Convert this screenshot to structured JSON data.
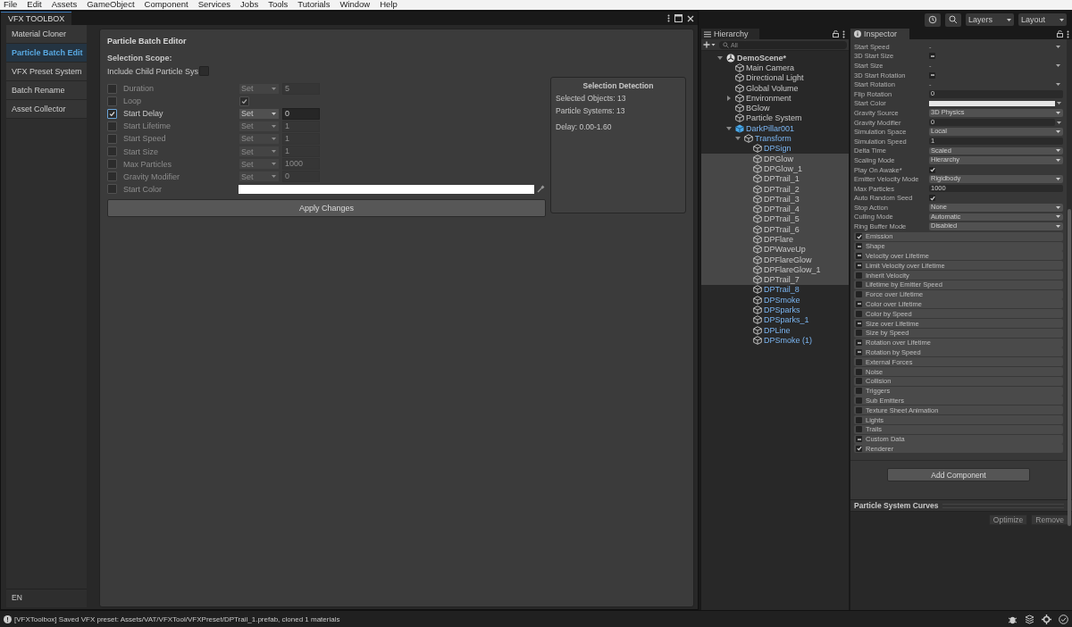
{
  "menu_bar": [
    "File",
    "Edit",
    "Assets",
    "GameObject",
    "Component",
    "Services",
    "Jobs",
    "Tools",
    "Tutorials",
    "Window",
    "Help"
  ],
  "toolbox": {
    "title": "VFX TOOLBOX",
    "sidebar": [
      {
        "label": "Material Cloner",
        "selected": false
      },
      {
        "label": "Particle Batch Edit",
        "selected": true
      },
      {
        "label": "VFX Preset System",
        "selected": false
      },
      {
        "label": "Batch Rename",
        "selected": false
      },
      {
        "label": "Asset Collector",
        "selected": false
      }
    ],
    "language": "EN",
    "editor": {
      "title": "Particle Batch Editor",
      "scope_label": "Selection Scope:",
      "include_child": {
        "label": "Include Child Particle Sys",
        "checked": false
      },
      "rows": [
        {
          "kind": "value",
          "label": "Duration",
          "enabled": false,
          "mode": "Set",
          "value": "5"
        },
        {
          "kind": "toggle",
          "label": "Loop",
          "enabled": false,
          "checked": true
        },
        {
          "kind": "value",
          "label": "Start Delay",
          "enabled": true,
          "mode": "Set",
          "value": "0"
        },
        {
          "kind": "value",
          "label": "Start Lifetime",
          "enabled": false,
          "mode": "Set",
          "value": "1"
        },
        {
          "kind": "value",
          "label": "Start Speed",
          "enabled": false,
          "mode": "Set",
          "value": "1"
        },
        {
          "kind": "value",
          "label": "Start Size",
          "enabled": false,
          "mode": "Set",
          "value": "1"
        },
        {
          "kind": "value",
          "label": "Max Particles",
          "enabled": false,
          "mode": "Set",
          "value": "1000"
        },
        {
          "kind": "value",
          "label": "Gravity Modifier",
          "enabled": false,
          "mode": "Set",
          "value": "0"
        },
        {
          "kind": "color",
          "label": "Start Color",
          "enabled": false
        }
      ],
      "apply_button": "Apply Changes",
      "detection": {
        "title": "Selection Detection",
        "lines": [
          "Selected Objects: 13",
          "Particle Systems: 13"
        ],
        "delay": "Delay: 0.00-1.60"
      }
    }
  },
  "toolbar": {
    "layers": "Layers",
    "layout": "Layout"
  },
  "hierarchy": {
    "title": "Hierarchy",
    "search": {
      "placeholder": "All"
    },
    "tree": [
      {
        "name": "DemoScene*",
        "kind": "scene",
        "linked": false,
        "selected": false,
        "expanded": true,
        "children": [
          {
            "name": "Main Camera",
            "kind": "object",
            "linked": false,
            "selected": false
          },
          {
            "name": "Directional Light",
            "kind": "object",
            "linked": false,
            "selected": false
          },
          {
            "name": "Global Volume",
            "kind": "object",
            "linked": false,
            "selected": false
          },
          {
            "name": "Environment",
            "kind": "object",
            "linked": false,
            "selected": false,
            "expanded": false
          },
          {
            "name": "BGlow",
            "kind": "object",
            "linked": false,
            "selected": false
          },
          {
            "name": "Particle System",
            "kind": "object",
            "linked": false,
            "selected": false
          },
          {
            "name": "DarkPillar001",
            "kind": "prefab",
            "linked": true,
            "selected": false,
            "expanded": true,
            "children": [
              {
                "name": "Transform",
                "kind": "object",
                "linked": true,
                "selected": false,
                "expanded": true,
                "children": [
                  {
                    "name": "DPSign",
                    "kind": "object",
                    "linked": true,
                    "selected": false
                  },
                  {
                    "name": "DPGlow",
                    "kind": "object",
                    "linked": false,
                    "selected": true
                  },
                  {
                    "name": "DPGlow_1",
                    "kind": "object",
                    "linked": false,
                    "selected": true
                  },
                  {
                    "name": "DPTrail_1",
                    "kind": "object",
                    "linked": false,
                    "selected": true
                  },
                  {
                    "name": "DPTrail_2",
                    "kind": "object",
                    "linked": false,
                    "selected": true
                  },
                  {
                    "name": "DPTrail_3",
                    "kind": "object",
                    "linked": false,
                    "selected": true
                  },
                  {
                    "name": "DPTrail_4",
                    "kind": "object",
                    "linked": false,
                    "selected": true
                  },
                  {
                    "name": "DPTrail_5",
                    "kind": "object",
                    "linked": false,
                    "selected": true
                  },
                  {
                    "name": "DPTrail_6",
                    "kind": "object",
                    "linked": false,
                    "selected": true
                  },
                  {
                    "name": "DPFlare",
                    "kind": "object",
                    "linked": false,
                    "selected": true
                  },
                  {
                    "name": "DPWaveUp",
                    "kind": "object",
                    "linked": false,
                    "selected": true
                  },
                  {
                    "name": "DPFlareGlow",
                    "kind": "object",
                    "linked": false,
                    "selected": true
                  },
                  {
                    "name": "DPFlareGlow_1",
                    "kind": "object",
                    "linked": false,
                    "selected": true
                  },
                  {
                    "name": "DPTrail_7",
                    "kind": "object",
                    "linked": false,
                    "selected": true
                  },
                  {
                    "name": "DPTrail_8",
                    "kind": "object",
                    "linked": true,
                    "selected": false
                  },
                  {
                    "name": "DPSmoke",
                    "kind": "object",
                    "linked": true,
                    "selected": false
                  },
                  {
                    "name": "DPSparks",
                    "kind": "object",
                    "linked": true,
                    "selected": false
                  },
                  {
                    "name": "DPSparks_1",
                    "kind": "object",
                    "linked": true,
                    "selected": false
                  },
                  {
                    "name": "DPLine",
                    "kind": "object",
                    "linked": true,
                    "selected": false
                  },
                  {
                    "name": "DPSmoke (1)",
                    "kind": "object",
                    "linked": true,
                    "selected": false
                  }
                ]
              }
            ]
          }
        ]
      }
    ]
  },
  "inspector": {
    "title": "Inspector",
    "properties": [
      {
        "label": "Start Speed",
        "kind": "curve",
        "value": "-"
      },
      {
        "label": "3D Start Size",
        "kind": "toggle",
        "mixed": true
      },
      {
        "label": "Start Size",
        "kind": "curve",
        "value": "-"
      },
      {
        "label": "3D Start Rotation",
        "kind": "toggle",
        "mixed": true
      },
      {
        "label": "Start Rotation",
        "kind": "curve",
        "value": "-"
      },
      {
        "label": "Flip Rotation",
        "kind": "field",
        "value": "0"
      },
      {
        "label": "Start Color",
        "kind": "color"
      },
      {
        "label": "Gravity Source",
        "kind": "dropdown",
        "value": "3D Physics"
      },
      {
        "label": "Gravity Modifier",
        "kind": "field_curve",
        "value": "0"
      },
      {
        "label": "Simulation Space",
        "kind": "dropdown",
        "value": "Local"
      },
      {
        "label": "Simulation Speed",
        "kind": "field",
        "value": "1"
      },
      {
        "label": "Delta Time",
        "kind": "dropdown",
        "value": "Scaled"
      },
      {
        "label": "Scaling Mode",
        "kind": "dropdown",
        "value": "Hierarchy"
      },
      {
        "label": "Play On Awake*",
        "kind": "toggle",
        "checked": true
      },
      {
        "label": "Emitter Velocity Mode",
        "kind": "dropdown",
        "value": "Rigidbody"
      },
      {
        "label": "Max Particles",
        "kind": "field",
        "value": "1000"
      },
      {
        "label": "Auto Random Seed",
        "kind": "toggle",
        "checked": true
      },
      {
        "label": "Stop Action",
        "kind": "dropdown",
        "value": "None"
      },
      {
        "label": "Culling Mode",
        "kind": "dropdown",
        "value": "Automatic"
      },
      {
        "label": "Ring Buffer Mode",
        "kind": "dropdown",
        "value": "Disabled"
      }
    ],
    "modules": [
      {
        "label": "Emission",
        "checked": true
      },
      {
        "label": "Shape",
        "mixed": true
      },
      {
        "label": "Velocity over Lifetime",
        "mixed": true
      },
      {
        "label": "Limit Velocity over Lifetime",
        "mixed": true
      },
      {
        "label": "Inherit Velocity",
        "checked": false
      },
      {
        "label": "Lifetime by Emitter Speed",
        "checked": false
      },
      {
        "label": "Force over Lifetime",
        "checked": false
      },
      {
        "label": "Color over Lifetime",
        "mixed": true
      },
      {
        "label": "Color by Speed",
        "checked": false
      },
      {
        "label": "Size over Lifetime",
        "mixed": true
      },
      {
        "label": "Size by Speed",
        "checked": false
      },
      {
        "label": "Rotation over Lifetime",
        "mixed": true
      },
      {
        "label": "Rotation by Speed",
        "mixed": true
      },
      {
        "label": "External Forces",
        "checked": false
      },
      {
        "label": "Noise",
        "checked": false
      },
      {
        "label": "Collision",
        "checked": false
      },
      {
        "label": "Triggers",
        "checked": false
      },
      {
        "label": "Sub Emitters",
        "checked": false
      },
      {
        "label": "Texture Sheet Animation",
        "checked": false
      },
      {
        "label": "Lights",
        "checked": false
      },
      {
        "label": "Trails",
        "checked": false
      },
      {
        "label": "Custom Data",
        "mixed": true
      },
      {
        "label": "Renderer",
        "checked": true
      }
    ],
    "add_button": "Add Component",
    "curves": {
      "title": "Particle System Curves",
      "buttons": [
        "Optimize",
        "Remove"
      ]
    }
  },
  "status_bar": {
    "message": "[VFXToolbox] Saved VFX preset: Assets/VAT/VFXTool/VFXPreset/DPTrail_1.prefab, cloned 1 materials"
  }
}
